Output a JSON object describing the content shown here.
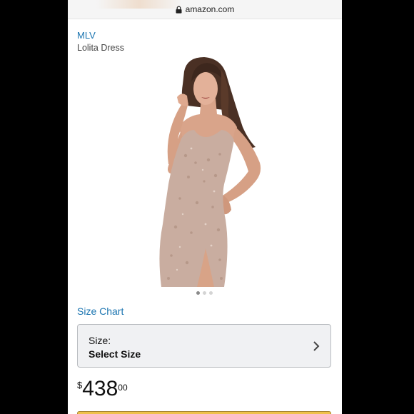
{
  "browser": {
    "domain": "amazon.com",
    "lock_icon": "lock-icon"
  },
  "product": {
    "brand": "MLV",
    "name": "Lolita Dress",
    "image_icon": "product-photo",
    "image_count": 3,
    "image_active_index": 0
  },
  "size_chart": {
    "label": "Size Chart"
  },
  "size_selector": {
    "label": "Size:",
    "value": "Select Size",
    "chevron_icon": "chevron-right-icon"
  },
  "price": {
    "currency": "$",
    "whole": "438",
    "fraction": "00"
  },
  "colors": {
    "link": "#1a74b0",
    "selector_bg": "#f0f1f3",
    "cart_button": "#f0c14b"
  }
}
